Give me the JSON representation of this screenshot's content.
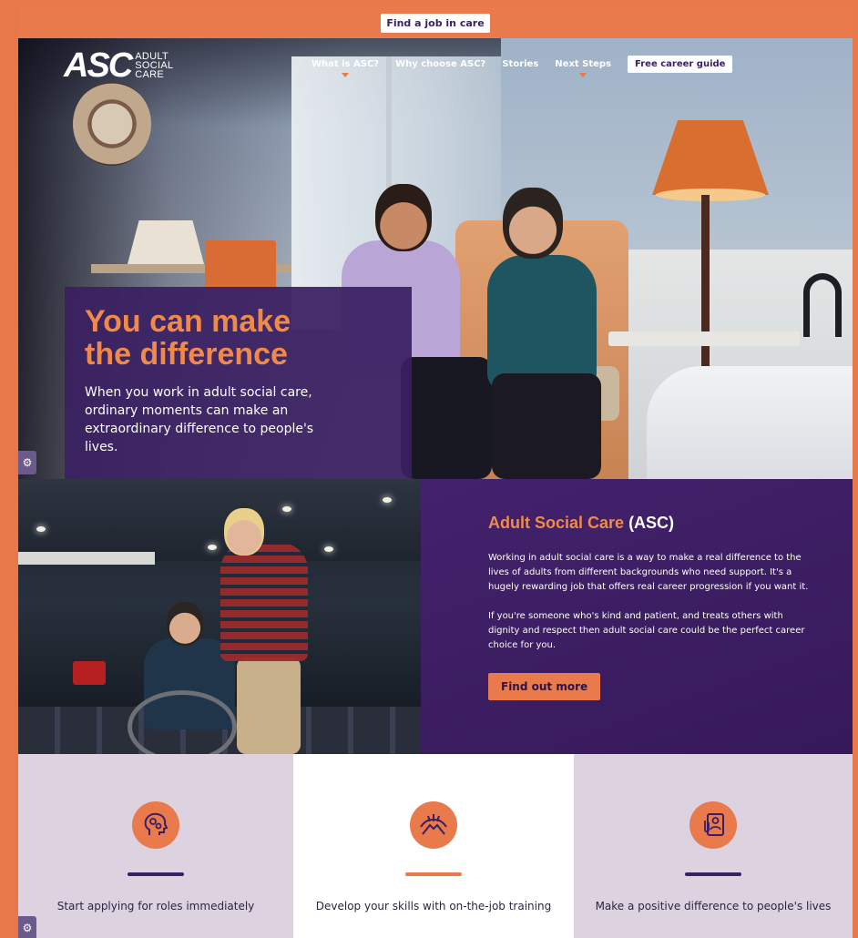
{
  "top_banner": {
    "cta_label": "Find a job in care"
  },
  "header": {
    "logo_mark": "ASC",
    "logo_words": [
      "ADULT",
      "SOCIAL",
      "CARE"
    ],
    "nav": [
      {
        "label": "What is ASC?",
        "has_dropdown": true
      },
      {
        "label": "Why choose ASC?",
        "has_dropdown": false
      },
      {
        "label": "Stories",
        "has_dropdown": false
      },
      {
        "label": "Next Steps",
        "has_dropdown": true
      }
    ],
    "cta_label": "Free career guide"
  },
  "hero": {
    "title_line1": "You can make",
    "title_line2": "the difference",
    "text": "When you work in adult social care, ordinary moments can make an extraordinary difference to people's lives."
  },
  "about": {
    "title_orange": "Adult Social Care",
    "title_white": "(ASC)",
    "paragraph1": "Working in adult social care is a way to make a real difference to the lives of adults from different backgrounds who need support. It's a hugely rewarding job that offers real career progression if you want it.",
    "paragraph2": "If you're someone who's kind and patient, and treats others with dignity and respect then adult social care could be the perfect career choice for you.",
    "button_label": "Find out more"
  },
  "features": [
    {
      "icon": "head-gears-icon",
      "text": "Start applying for roles immediately"
    },
    {
      "icon": "hands-training-icon",
      "text": "Develop your skills with on-the-job training"
    },
    {
      "icon": "profile-document-icon",
      "text": "Make a positive difference to people's lives"
    }
  ],
  "colors": {
    "accent_orange": "#e97a4b",
    "brand_purple": "#3a1f62",
    "feature_bg": "#dcd2e0"
  },
  "side_tabs": {
    "icon": "gear-icon",
    "glyph": "⚙"
  }
}
